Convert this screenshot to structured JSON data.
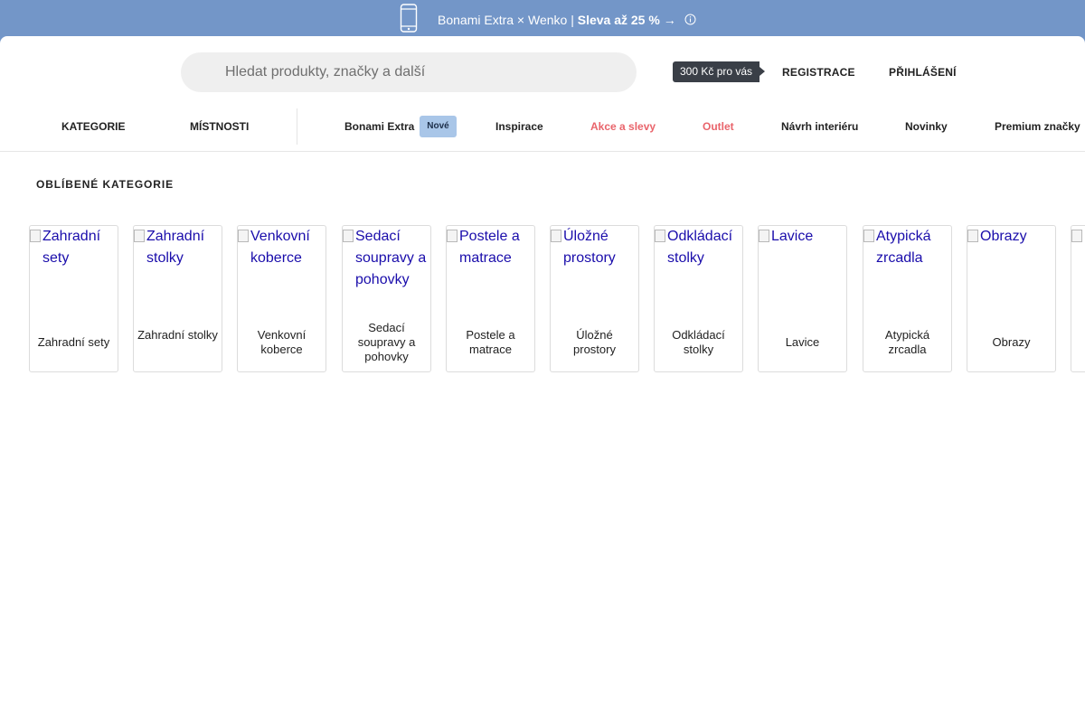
{
  "promo": {
    "text_plain": "Bonami Extra × Wenko | ",
    "text_bold": "Sleva až 25 %",
    "arrow": "→",
    "icons": {
      "phone": "phone-icon",
      "info": "info-icon"
    },
    "color": "#7396c8"
  },
  "header": {
    "search_placeholder": "Hledat produkty, značky a další",
    "bonus_tag": "300 Kč pro vás",
    "register": "REGISTRACE",
    "login": "PŘIHLÁŠENÍ"
  },
  "nav": {
    "categories": "KATEGORIE",
    "rooms": "MÍSTNOSTI",
    "bonami_extra": "Bonami Extra",
    "new_badge": "Nové",
    "inspiration": "Inspirace",
    "sales": "Akce a slevy",
    "outlet": "Outlet",
    "interior_design": "Návrh interiéru",
    "news": "Novinky",
    "premium": "Premium značky",
    "accent_red": "#e9646b"
  },
  "favorites": {
    "title": "OBLÍBENÉ KATEGORIE",
    "items": [
      {
        "alt": "Zahradní sety",
        "label": "Zahradní sety"
      },
      {
        "alt": "Zahradní stolky",
        "label": "Zahradní stolky"
      },
      {
        "alt": "Venkovní koberce",
        "label": "Venkovní koberce"
      },
      {
        "alt": "Sedací soupravy a pohovky",
        "label": "Sedací soupravy a pohovky"
      },
      {
        "alt": "Postele a matrace",
        "label": "Postele a matrace"
      },
      {
        "alt": "Úložné prostory",
        "label": "Úložné prostory"
      },
      {
        "alt": "Odkládací stolky",
        "label": "Odkládací stolky"
      },
      {
        "alt": "Lavice",
        "label": "Lavice"
      },
      {
        "alt": "Atypická zrcadla",
        "label": "Atypická zrcadla"
      },
      {
        "alt": "Obrazy",
        "label": "Obrazy"
      }
    ]
  }
}
